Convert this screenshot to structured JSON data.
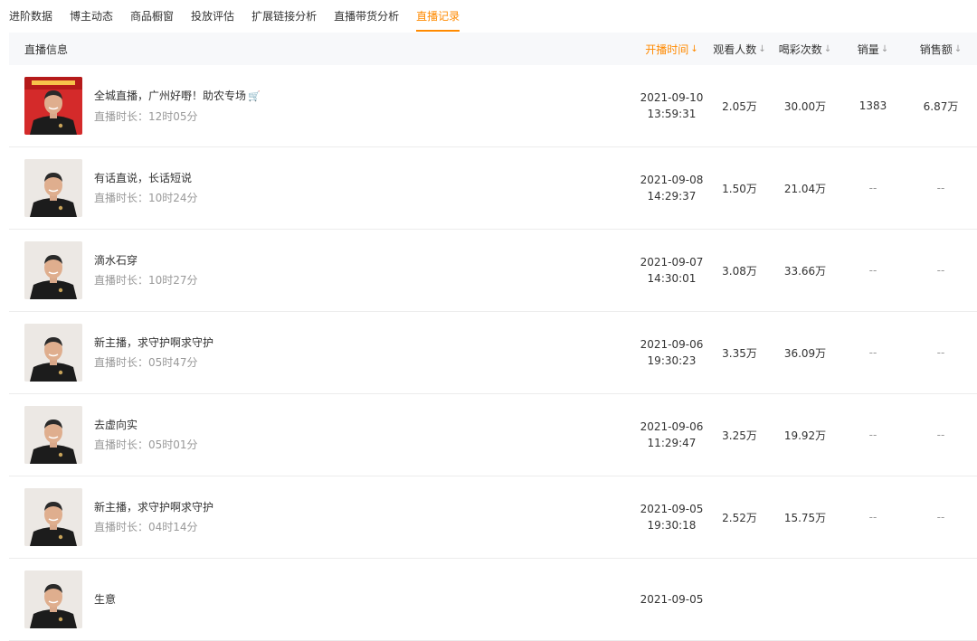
{
  "tabs": [
    {
      "label": "进阶数据"
    },
    {
      "label": "博主动态"
    },
    {
      "label": "商品橱窗"
    },
    {
      "label": "投放评估"
    },
    {
      "label": "扩展链接分析"
    },
    {
      "label": "直播带货分析"
    },
    {
      "label": "直播记录",
      "active": true
    }
  ],
  "table": {
    "headers": {
      "info": "直播信息",
      "time": "开播时间",
      "viewers": "观看人数",
      "likes": "喝彩次数",
      "sales": "销量",
      "amount": "销售额"
    },
    "duration_prefix": "直播时长：",
    "rows": [
      {
        "title": "全城直播，广州好嘢！助农专场",
        "duration": "12时05分",
        "date": "2021-09-10",
        "clock": "13:59:31",
        "viewers": "2.05万",
        "likes": "30.00万",
        "sales": "1383",
        "amount": "6.87万",
        "has_cart": true,
        "cover_style": "red"
      },
      {
        "title": "有话直说，长话短说",
        "duration": "10时24分",
        "date": "2021-09-08",
        "clock": "14:29:37",
        "viewers": "1.50万",
        "likes": "21.04万",
        "sales": "--",
        "amount": "--"
      },
      {
        "title": "滴水石穿",
        "duration": "10时27分",
        "date": "2021-09-07",
        "clock": "14:30:01",
        "viewers": "3.08万",
        "likes": "33.66万",
        "sales": "--",
        "amount": "--"
      },
      {
        "title": "新主播，求守护啊求守护",
        "duration": "05时47分",
        "date": "2021-09-06",
        "clock": "19:30:23",
        "viewers": "3.35万",
        "likes": "36.09万",
        "sales": "--",
        "amount": "--"
      },
      {
        "title": "去虚向实",
        "duration": "05时01分",
        "date": "2021-09-06",
        "clock": "11:29:47",
        "viewers": "3.25万",
        "likes": "19.92万",
        "sales": "--",
        "amount": "--"
      },
      {
        "title": "新主播，求守护啊求守护",
        "duration": "04时14分",
        "date": "2021-09-05",
        "clock": "19:30:18",
        "viewers": "2.52万",
        "likes": "15.75万",
        "sales": "--",
        "amount": "--"
      },
      {
        "title": "生意",
        "duration": "",
        "date": "2021-09-05",
        "clock": "",
        "viewers": "",
        "likes": "",
        "sales": "",
        "amount": ""
      }
    ]
  },
  "colors": {
    "accent": "#ff8a00",
    "header_bg": "#f7f8fa",
    "muted": "#999999",
    "border": "#ececec"
  }
}
